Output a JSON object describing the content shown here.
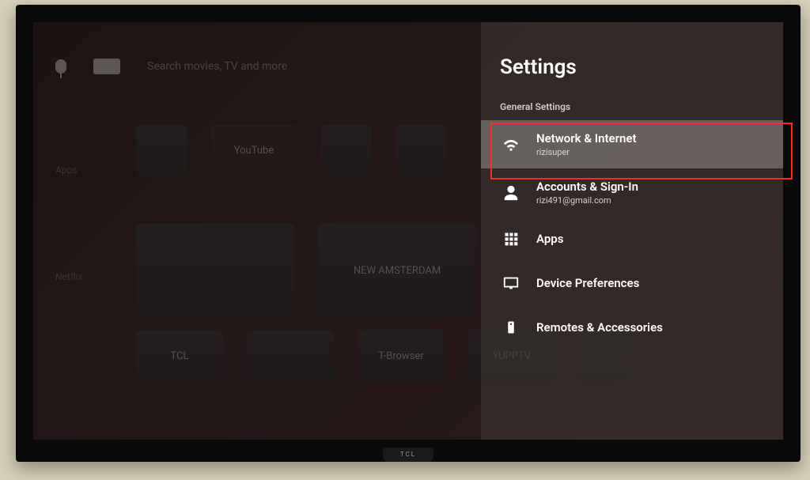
{
  "search": {
    "placeholder": "Search movies, TV and more"
  },
  "home": {
    "rowLabels": {
      "apps": "Apps",
      "netflix": "Netflix"
    },
    "tiles": {
      "youtube": "YouTube",
      "tbrowser": "T-Browser",
      "yupptv": "YUPPTV",
      "tclchannel": "TCL",
      "newamsterdam": "NEW AMSTERDAM"
    }
  },
  "settings": {
    "title": "Settings",
    "section": "General Settings",
    "items": [
      {
        "label": "Network & Internet",
        "sub": "rizisuper",
        "highlighted": true
      },
      {
        "label": "Accounts & Sign-In",
        "sub": "rizi491@gmail.com",
        "highlighted": false
      },
      {
        "label": "Apps",
        "sub": "",
        "highlighted": false
      },
      {
        "label": "Device Preferences",
        "sub": "",
        "highlighted": false
      },
      {
        "label": "Remotes & Accessories",
        "sub": "",
        "highlighted": false
      }
    ]
  }
}
